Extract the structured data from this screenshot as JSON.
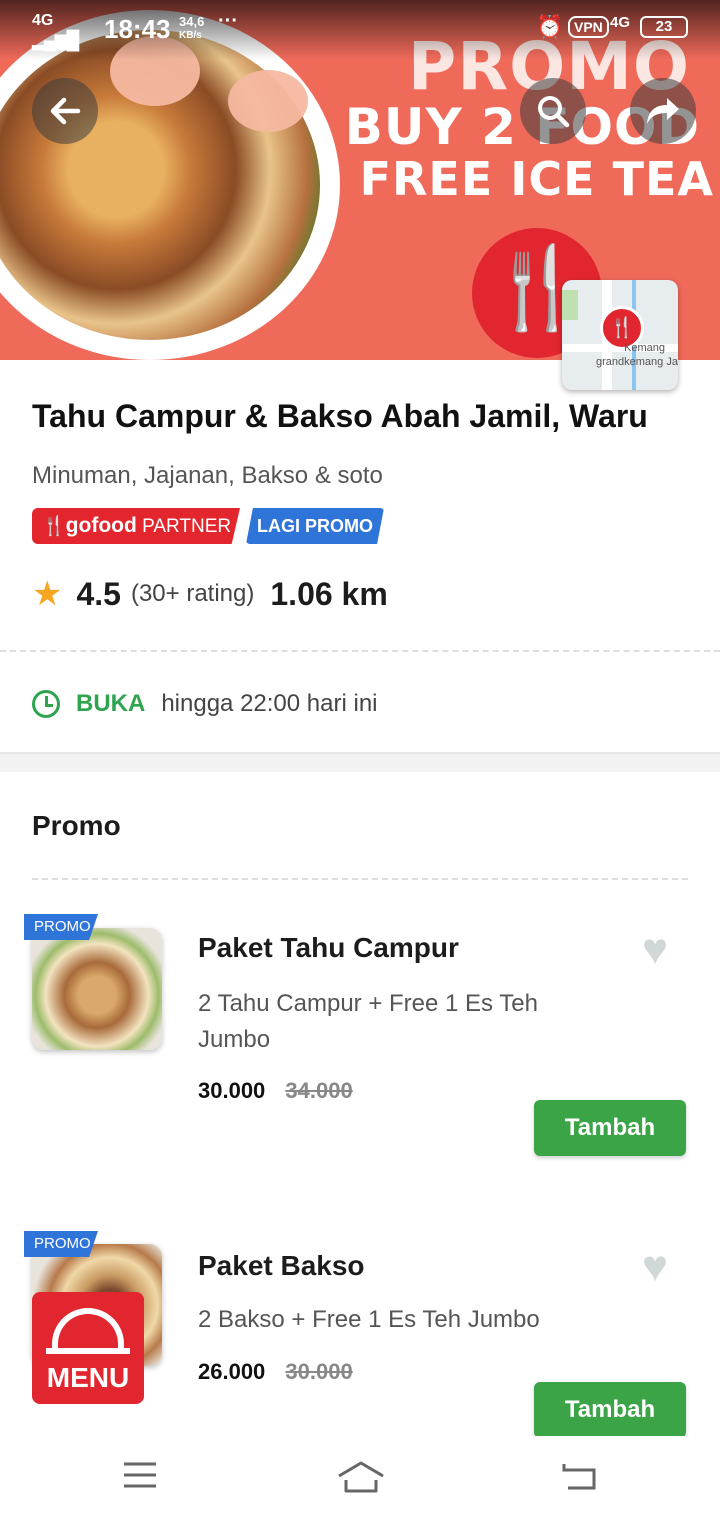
{
  "status_bar": {
    "network": "4G",
    "time": "18:43",
    "speed_value": "34,6",
    "speed_unit": "KB/s",
    "more": "···",
    "vpn": "VPN",
    "network_right": "4G",
    "battery": "23"
  },
  "banner": {
    "line1": "PROMO",
    "line2": "BUY 2 FOOD",
    "line3": "FREE ICE TEA",
    "map_label_1": "Kemang",
    "map_label_2": "grandkemang Ja"
  },
  "restaurant": {
    "name": "Tahu Campur & Bakso Abah Jamil, Waru",
    "categories": "Minuman, Jajanan, Bakso & soto",
    "badge_brand": "gofood",
    "badge_partner": "PARTNER",
    "badge_promo": "LAGI PROMO",
    "rating": "4.5",
    "rating_count": "(30+ rating)",
    "distance": "1.06 km",
    "open_label": "BUKA",
    "open_text": "hingga 22:00 hari ini"
  },
  "section": {
    "title": "Promo"
  },
  "items": [
    {
      "tag": "PROMO",
      "name": "Paket Tahu Campur",
      "desc": "2 Tahu Campur + Free 1 Es Teh Jumbo",
      "price": "30.000",
      "old_price": "34.000",
      "button": "Tambah"
    },
    {
      "tag": "PROMO",
      "name": "Paket Bakso",
      "desc": "2 Bakso + Free 1 Es Teh Jumbo",
      "price": "26.000",
      "old_price": "30.000",
      "button": "Tambah"
    }
  ],
  "menu_fab": {
    "label": "MENU"
  },
  "icons": {
    "back": "back-arrow-icon",
    "search": "search-icon",
    "share": "share-icon",
    "star": "star-icon",
    "clock": "clock-icon",
    "heart": "heart-icon",
    "menu": "cloche-icon",
    "nav_menu": "hamburger-icon",
    "nav_home": "home-icon",
    "nav_back": "back-icon"
  },
  "colors": {
    "banner": "#f06a5a",
    "brand_red": "#e2262f",
    "promo_blue": "#2f74d8",
    "green": "#3aa447",
    "star": "#f5a623"
  }
}
